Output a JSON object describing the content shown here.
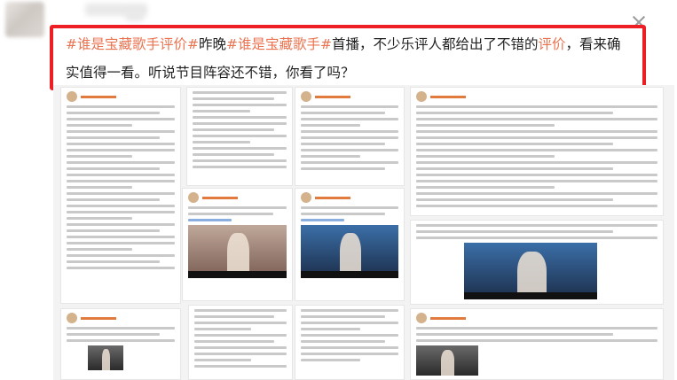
{
  "post": {
    "tag1": "#谁是宝藏歌手评价#",
    "text1": "昨晚",
    "tag2": "#谁是宝藏歌手#",
    "text2": "首播，不少乐评人都给出了不错的",
    "link": "评价",
    "text3": "，看来确实值得一看。听说节目阵容还不错，你看了吗？"
  },
  "colors": {
    "hashtag": "#eb7350",
    "highlight_border": "#ee1f24"
  },
  "icons": {
    "close": "close-icon"
  }
}
